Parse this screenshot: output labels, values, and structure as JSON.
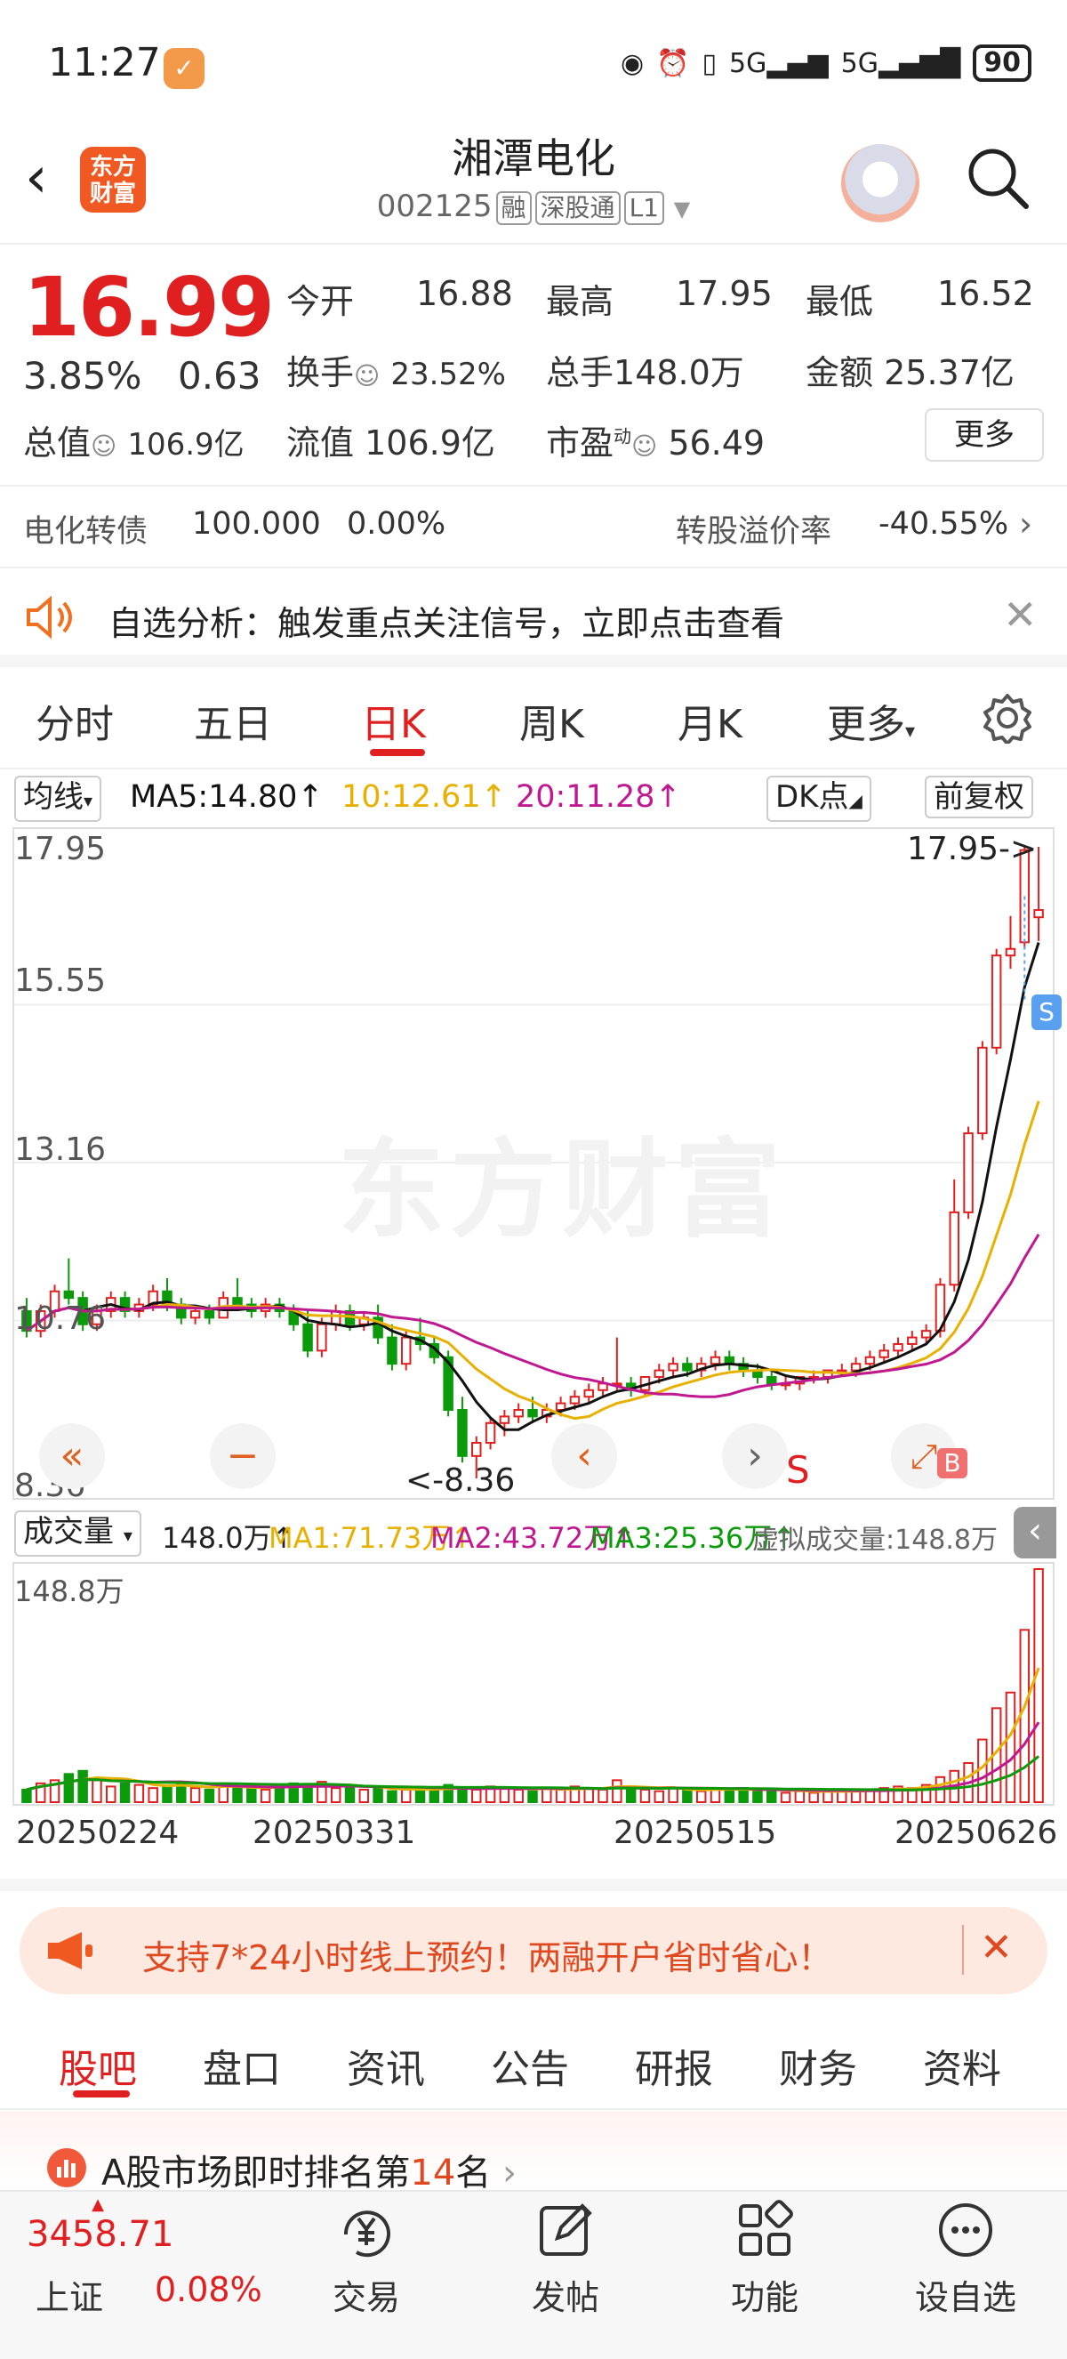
{
  "status_bar": {
    "time": "11:27",
    "battery": "90",
    "signal1": "5G",
    "signal2": "5G"
  },
  "header": {
    "title": "湘潭电化",
    "code": "002125",
    "tags": [
      "融",
      "深股通",
      "L1"
    ],
    "logo_text": "东方财富"
  },
  "quote": {
    "price": "16.99",
    "change_pct": "3.85%",
    "change": "0.63",
    "open_label": "今开",
    "open": "16.88",
    "high_label": "最高",
    "high": "17.95",
    "low_label": "最低",
    "low": "16.52",
    "turnover_label": "换手",
    "turnover": "23.52%",
    "volume_label": "总手",
    "volume": "148.0万",
    "amount_label": "金额",
    "amount": "25.37亿",
    "mcap_label": "总值",
    "mcap": "106.9亿",
    "float_label": "流值",
    "float": "106.9亿",
    "pe_label": "市盈",
    "pe_sup": "动",
    "pe": "56.49",
    "more": "更多"
  },
  "bond": {
    "name": "电化转债",
    "price": "100.000",
    "change": "0.00%",
    "premium_label": "转股溢价率",
    "premium": "-40.55%"
  },
  "notice": {
    "text": "自选分析：触发重点关注信号，立即点击查看"
  },
  "chart_tabs": [
    "分时",
    "五日",
    "日K",
    "周K",
    "月K",
    "更多"
  ],
  "active_tab": "日K",
  "ma_legend": {
    "selector": "均线",
    "ma5": "MA5:14.80↑",
    "ma10": "10:12.61↑",
    "ma20": "20:11.28↑",
    "dk": "DK点",
    "adjust": "前复权"
  },
  "colors": {
    "ma5": "#111111",
    "ma10": "#e8b000",
    "ma20": "#c01890",
    "up": "#e02020",
    "down": "#0a9a0a"
  },
  "price_axis": {
    "labels": [
      "17.95",
      "15.55",
      "13.16",
      "10.76",
      "8.36"
    ],
    "max_label": "17.95->",
    "min_label": "<-8.36",
    "watermark": "东方财富"
  },
  "volume_legend": {
    "selector": "成交量",
    "vol": "148.0万↑",
    "ma1": "MA1:71.73万↑",
    "ma2": "MA2:43.72万↑",
    "ma3": "MA3:25.36万↑",
    "virtual": "虚拟成交量:148.8万"
  },
  "volume_axis": {
    "top": "148.8万"
  },
  "dates": [
    "20250224",
    "20250331",
    "20250515",
    "20250626"
  ],
  "markers": {
    "sell": "S",
    "buy": "B"
  },
  "promo": {
    "text": "支持7*24小时线上预约！两融开户省时省心！"
  },
  "bottom_tabs": [
    "股吧",
    "盘口",
    "资讯",
    "公告",
    "研报",
    "财务",
    "资料"
  ],
  "active_bottom_tab": "股吧",
  "rank": {
    "prefix": "A股市场即时排名第",
    "num": "14",
    "suffix": "名"
  },
  "index": {
    "value": "3458.71",
    "name": "上证",
    "change": "0.08%"
  },
  "nav": [
    "交易",
    "发帖",
    "功能",
    "设自选"
  ],
  "chart_data": {
    "type": "candlestick",
    "ylim": [
      8.36,
      17.95
    ],
    "ohlc": [
      [
        10.9,
        11.1,
        10.5,
        10.6
      ],
      [
        10.6,
        11.0,
        10.5,
        10.9
      ],
      [
        10.9,
        11.3,
        10.8,
        11.2
      ],
      [
        11.2,
        11.7,
        11.0,
        11.1
      ],
      [
        11.1,
        11.2,
        10.6,
        10.7
      ],
      [
        10.7,
        11.0,
        10.6,
        10.9
      ],
      [
        10.9,
        11.2,
        10.8,
        11.1
      ],
      [
        11.1,
        11.2,
        10.8,
        10.9
      ],
      [
        10.9,
        11.1,
        10.8,
        11.0
      ],
      [
        11.0,
        11.3,
        10.9,
        11.2
      ],
      [
        11.2,
        11.4,
        10.9,
        11.0
      ],
      [
        11.0,
        11.1,
        10.7,
        10.8
      ],
      [
        10.8,
        11.0,
        10.7,
        10.9
      ],
      [
        10.9,
        11.0,
        10.7,
        10.8
      ],
      [
        10.8,
        11.2,
        10.8,
        11.1
      ],
      [
        11.1,
        11.4,
        11.0,
        11.0
      ],
      [
        11.0,
        11.1,
        10.8,
        10.9
      ],
      [
        10.9,
        11.1,
        10.8,
        11.0
      ],
      [
        11.0,
        11.1,
        10.8,
        10.9
      ],
      [
        10.9,
        11.0,
        10.6,
        10.7
      ],
      [
        10.7,
        10.9,
        10.2,
        10.3
      ],
      [
        10.3,
        10.8,
        10.2,
        10.7
      ],
      [
        10.7,
        11.0,
        10.6,
        10.9
      ],
      [
        10.9,
        11.0,
        10.6,
        10.7
      ],
      [
        10.7,
        10.9,
        10.6,
        10.8
      ],
      [
        10.8,
        11.0,
        10.4,
        10.5
      ],
      [
        10.5,
        10.7,
        10.0,
        10.1
      ],
      [
        10.1,
        10.6,
        10.0,
        10.5
      ],
      [
        10.5,
        10.8,
        10.3,
        10.4
      ],
      [
        10.4,
        10.5,
        10.1,
        10.2
      ],
      [
        10.2,
        10.3,
        9.3,
        9.4
      ],
      [
        9.4,
        9.6,
        8.6,
        8.7
      ],
      [
        8.7,
        9.0,
        8.36,
        8.9
      ],
      [
        8.9,
        9.3,
        8.8,
        9.2
      ],
      [
        9.2,
        9.4,
        9.0,
        9.3
      ],
      [
        9.3,
        9.5,
        9.2,
        9.4
      ],
      [
        9.4,
        9.6,
        9.2,
        9.3
      ],
      [
        9.3,
        9.5,
        9.2,
        9.4
      ],
      [
        9.4,
        9.6,
        9.3,
        9.5
      ],
      [
        9.5,
        9.7,
        9.4,
        9.6
      ],
      [
        9.6,
        9.8,
        9.5,
        9.7
      ],
      [
        9.7,
        9.9,
        9.6,
        9.8
      ],
      [
        9.8,
        10.5,
        9.7,
        9.8
      ],
      [
        9.8,
        9.9,
        9.6,
        9.7
      ],
      [
        9.7,
        9.9,
        9.6,
        9.9
      ],
      [
        9.9,
        10.1,
        9.8,
        10.0
      ],
      [
        10.0,
        10.2,
        9.9,
        10.1
      ],
      [
        10.1,
        10.2,
        9.9,
        10.0
      ],
      [
        10.0,
        10.2,
        9.9,
        10.1
      ],
      [
        10.1,
        10.3,
        10.0,
        10.2
      ],
      [
        10.2,
        10.3,
        10.0,
        10.1
      ],
      [
        10.1,
        10.2,
        9.9,
        10.0
      ],
      [
        10.0,
        10.1,
        9.8,
        9.9
      ],
      [
        9.9,
        10.0,
        9.7,
        9.8
      ],
      [
        9.8,
        9.9,
        9.7,
        9.8
      ],
      [
        9.8,
        9.9,
        9.7,
        9.9
      ],
      [
        9.9,
        10.0,
        9.8,
        9.9
      ],
      [
        9.9,
        10.0,
        9.8,
        10.0
      ],
      [
        10.0,
        10.1,
        9.9,
        10.0
      ],
      [
        10.0,
        10.2,
        9.9,
        10.1
      ],
      [
        10.1,
        10.3,
        10.0,
        10.2
      ],
      [
        10.2,
        10.4,
        10.1,
        10.3
      ],
      [
        10.3,
        10.5,
        10.2,
        10.4
      ],
      [
        10.4,
        10.6,
        10.3,
        10.5
      ],
      [
        10.5,
        10.7,
        10.4,
        10.6
      ],
      [
        10.6,
        11.4,
        10.5,
        11.3
      ],
      [
        11.3,
        12.9,
        11.2,
        12.4
      ],
      [
        12.4,
        13.7,
        12.3,
        13.6
      ],
      [
        13.6,
        15.0,
        13.5,
        14.9
      ],
      [
        14.9,
        16.4,
        14.8,
        16.3
      ],
      [
        16.3,
        16.9,
        16.1,
        16.4
      ],
      [
        16.5,
        17.95,
        16.4,
        17.9
      ],
      [
        16.88,
        17.95,
        16.52,
        16.99
      ]
    ],
    "volume": [
      8,
      12,
      14,
      18,
      20,
      14,
      10,
      12,
      11,
      9,
      10,
      12,
      9,
      8,
      11,
      10,
      9,
      8,
      10,
      12,
      11,
      13,
      9,
      10,
      8,
      9,
      7,
      8,
      9,
      8,
      11,
      9,
      8,
      10,
      9,
      8,
      7,
      9,
      8,
      10,
      9,
      8,
      14,
      9,
      8,
      7,
      9,
      8,
      7,
      9,
      8,
      9,
      7,
      8,
      6,
      7,
      6,
      7,
      8,
      7,
      8,
      9,
      10,
      9,
      11,
      16,
      20,
      25,
      40,
      60,
      70,
      110,
      148.8
    ],
    "vol_max": 148.8
  }
}
